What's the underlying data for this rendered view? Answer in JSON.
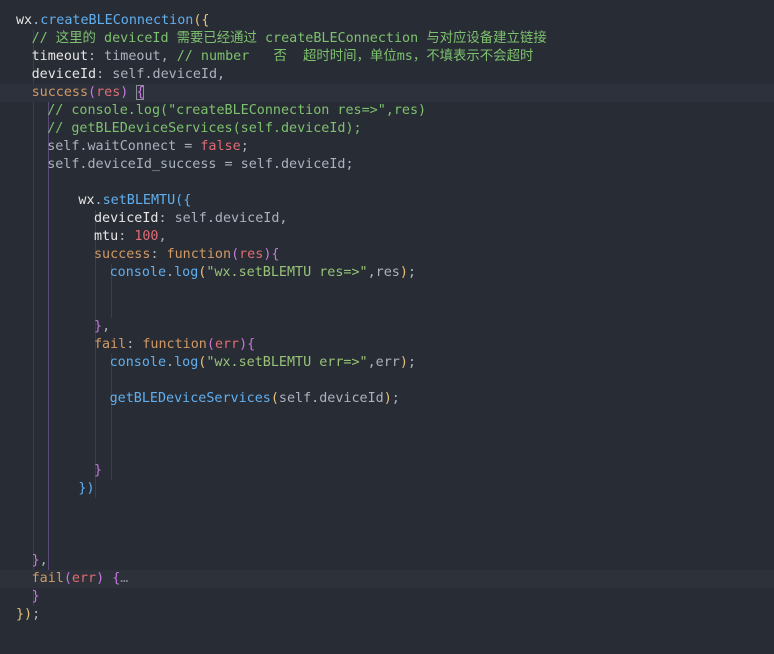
{
  "lines": [
    {
      "indent": 0,
      "tokens": [
        {
          "t": "wx",
          "c": "w"
        },
        {
          "t": ".",
          "c": "t"
        },
        {
          "t": "createBLEConnection",
          "c": "f"
        },
        {
          "t": "({",
          "c": "b1"
        }
      ]
    },
    {
      "indent": 1,
      "tokens": [
        {
          "t": "// 这里的 deviceId 需要已经通过 createBLEConnection 与对应设备建立链接",
          "c": "cg"
        }
      ]
    },
    {
      "indent": 1,
      "tokens": [
        {
          "t": "timeout",
          "c": "w"
        },
        {
          "t": ": timeout, ",
          "c": "t"
        },
        {
          "t": "// number   否  超时时间，单位ms，不填表示不会超时",
          "c": "cg"
        }
      ]
    },
    {
      "indent": 1,
      "tokens": [
        {
          "t": "deviceId",
          "c": "w"
        },
        {
          "t": ": self.deviceId,",
          "c": "t"
        }
      ]
    },
    {
      "indent": 1,
      "hl": true,
      "tokens": [
        {
          "t": "success",
          "c": "n"
        },
        {
          "t": "(",
          "c": "b2"
        },
        {
          "t": "res",
          "c": "p"
        },
        {
          "t": ")",
          "c": "b2"
        },
        {
          "t": " ",
          "c": "t"
        },
        {
          "t": "{",
          "c": "b2",
          "box": true
        }
      ]
    },
    {
      "indent": 2,
      "tokens": [
        {
          "t": "// console.log(\"createBLEConnection res=>\",res)",
          "c": "cg"
        }
      ]
    },
    {
      "indent": 2,
      "tokens": [
        {
          "t": "// getBLEDeviceServices(self.deviceId);",
          "c": "cg"
        }
      ]
    },
    {
      "indent": 2,
      "tokens": [
        {
          "t": "self.waitConnect = ",
          "c": "t"
        },
        {
          "t": "false",
          "c": "p"
        },
        {
          "t": ";",
          "c": "t"
        }
      ]
    },
    {
      "indent": 2,
      "tokens": [
        {
          "t": "self.deviceId_success = self.deviceId;",
          "c": "t"
        }
      ]
    },
    {
      "indent": 0,
      "tokens": []
    },
    {
      "indent": 4,
      "tokens": [
        {
          "t": "wx",
          "c": "w"
        },
        {
          "t": ".",
          "c": "t"
        },
        {
          "t": "setBLEMTU",
          "c": "f"
        },
        {
          "t": "({",
          "c": "b3"
        }
      ]
    },
    {
      "indent": 5,
      "tokens": [
        {
          "t": "deviceId",
          "c": "w"
        },
        {
          "t": ": self.deviceId,",
          "c": "t"
        }
      ]
    },
    {
      "indent": 5,
      "tokens": [
        {
          "t": "mtu",
          "c": "w"
        },
        {
          "t": ": ",
          "c": "t"
        },
        {
          "t": "100",
          "c": "p"
        },
        {
          "t": ",",
          "c": "t"
        }
      ]
    },
    {
      "indent": 5,
      "tokens": [
        {
          "t": "success",
          "c": "n"
        },
        {
          "t": ": ",
          "c": "t"
        },
        {
          "t": "function",
          "c": "n"
        },
        {
          "t": "(",
          "c": "b2"
        },
        {
          "t": "res",
          "c": "p"
        },
        {
          "t": "){",
          "c": "b2"
        }
      ]
    },
    {
      "indent": 6,
      "tokens": [
        {
          "t": "console",
          "c": "f"
        },
        {
          "t": ".",
          "c": "t"
        },
        {
          "t": "log",
          "c": "f"
        },
        {
          "t": "(",
          "c": "b1"
        },
        {
          "t": "\"wx.setBLEMTU res=>\"",
          "c": "s"
        },
        {
          "t": ",res",
          "c": "t"
        },
        {
          "t": ")",
          "c": "b1"
        },
        {
          "t": ";",
          "c": "t"
        }
      ]
    },
    {
      "indent": 0,
      "tokens": []
    },
    {
      "indent": 0,
      "tokens": []
    },
    {
      "indent": 5,
      "tokens": [
        {
          "t": "}",
          "c": "b2"
        },
        {
          "t": ",",
          "c": "t"
        }
      ]
    },
    {
      "indent": 5,
      "tokens": [
        {
          "t": "fail",
          "c": "n"
        },
        {
          "t": ": ",
          "c": "t"
        },
        {
          "t": "function",
          "c": "n"
        },
        {
          "t": "(",
          "c": "b2"
        },
        {
          "t": "err",
          "c": "p"
        },
        {
          "t": "){",
          "c": "b2"
        }
      ]
    },
    {
      "indent": 6,
      "tokens": [
        {
          "t": "console",
          "c": "f"
        },
        {
          "t": ".",
          "c": "t"
        },
        {
          "t": "log",
          "c": "f"
        },
        {
          "t": "(",
          "c": "b1"
        },
        {
          "t": "\"wx.setBLEMTU err=>\"",
          "c": "s"
        },
        {
          "t": ",err",
          "c": "t"
        },
        {
          "t": ")",
          "c": "b1"
        },
        {
          "t": ";",
          "c": "t"
        }
      ]
    },
    {
      "indent": 0,
      "tokens": []
    },
    {
      "indent": 6,
      "tokens": [
        {
          "t": "getBLEDeviceServices",
          "c": "f"
        },
        {
          "t": "(",
          "c": "b1"
        },
        {
          "t": "self.deviceId",
          "c": "t"
        },
        {
          "t": ")",
          "c": "b1"
        },
        {
          "t": ";",
          "c": "t"
        }
      ]
    },
    {
      "indent": 0,
      "tokens": []
    },
    {
      "indent": 0,
      "tokens": []
    },
    {
      "indent": 0,
      "tokens": []
    },
    {
      "indent": 5,
      "tokens": [
        {
          "t": "}",
          "c": "b2"
        }
      ]
    },
    {
      "indent": 4,
      "tokens": [
        {
          "t": "})",
          "c": "b3"
        }
      ]
    },
    {
      "indent": 0,
      "tokens": []
    },
    {
      "indent": 0,
      "tokens": []
    },
    {
      "indent": 0,
      "tokens": []
    },
    {
      "indent": 1,
      "tokens": [
        {
          "t": "}",
          "c": "b2"
        },
        {
          "t": ",",
          "c": "t"
        }
      ]
    },
    {
      "indent": 1,
      "hl2": true,
      "tokens": [
        {
          "t": "fail",
          "c": "n"
        },
        {
          "t": "(",
          "c": "b2"
        },
        {
          "t": "err",
          "c": "p"
        },
        {
          "t": ")",
          "c": "b2"
        },
        {
          "t": " ",
          "c": "t"
        },
        {
          "t": "{",
          "c": "b2"
        },
        {
          "t": "…",
          "c": "fold"
        }
      ]
    },
    {
      "indent": 1,
      "tokens": [
        {
          "t": "}",
          "c": "b2"
        }
      ]
    },
    {
      "indent": 0,
      "tokens": [
        {
          "t": "})",
          "c": "b1"
        },
        {
          "t": ";",
          "c": "t"
        }
      ]
    }
  ]
}
